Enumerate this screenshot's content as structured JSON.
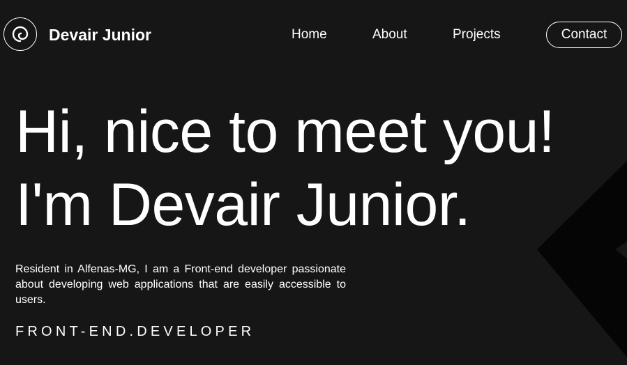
{
  "header": {
    "brand": "Devair Junior",
    "logo_icon": "swirl-icon",
    "nav": {
      "home": "Home",
      "about": "About",
      "projects": "Projects",
      "contact": "Contact"
    }
  },
  "hero": {
    "title_line1": "Hi, nice to meet you!",
    "title_line2": "I'm Devair Junior.",
    "intro": "Resident in Alfenas-MG, I am a Front-end developer passionate about developing web applications that are easily accessible to users.",
    "role": "FRONT-END.DEVELOPER"
  },
  "colors": {
    "background": "#161616",
    "text": "#ffffff",
    "decoration": "#050505"
  }
}
